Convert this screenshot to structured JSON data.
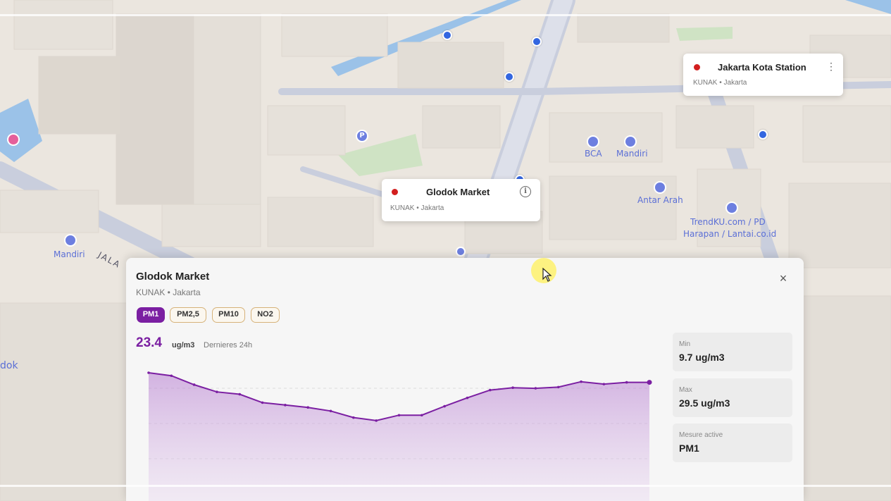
{
  "map": {
    "labels": [
      "BCA",
      "Mandiri",
      "Antar Arah",
      "TrendKU.com / PD",
      "Harapan / Lantai.co.id",
      "Mandiri",
      "JALA",
      "dok"
    ],
    "poi_parking": "P"
  },
  "popups": [
    {
      "name": "Jakarta Kota Station",
      "sub": "KUNAK • Jakarta",
      "status_color": "#d21f1f"
    },
    {
      "name": "Glodok Market",
      "sub": "KUNAK • Jakarta",
      "status_color": "#d21f1f"
    }
  ],
  "panel": {
    "title": "Glodok Market",
    "subtitle": "KUNAK • Jakarta",
    "close_icon": "×",
    "pills": [
      {
        "label": "PM1",
        "active": true
      },
      {
        "label": "PM2,5",
        "active": false
      },
      {
        "label": "PM10",
        "active": false
      },
      {
        "label": "NO2",
        "active": false
      }
    ],
    "current_value": "23.4",
    "unit": "ug/m3",
    "period": "Dernieres 24h",
    "stats": [
      {
        "label": "Min",
        "value": "9.7 ug/m3"
      },
      {
        "label": "Max",
        "value": "29.5 ug/m3"
      },
      {
        "label": "Mesure active",
        "value": "PM1"
      }
    ],
    "accent_color": "#7b1fa2"
  },
  "chart_data": {
    "type": "area",
    "series": [
      {
        "values": [
          29.5,
          29.0,
          27.5,
          26.3,
          25.9,
          24.5,
          24.1,
          23.7,
          23.1,
          22.0,
          21.5,
          22.4,
          22.4,
          23.9,
          25.3,
          26.6,
          27.0,
          26.9,
          27.1,
          28.0,
          27.6,
          27.9,
          27.9
        ]
      }
    ],
    "ylim": [
      9.7,
      29.5
    ],
    "grid": true
  }
}
